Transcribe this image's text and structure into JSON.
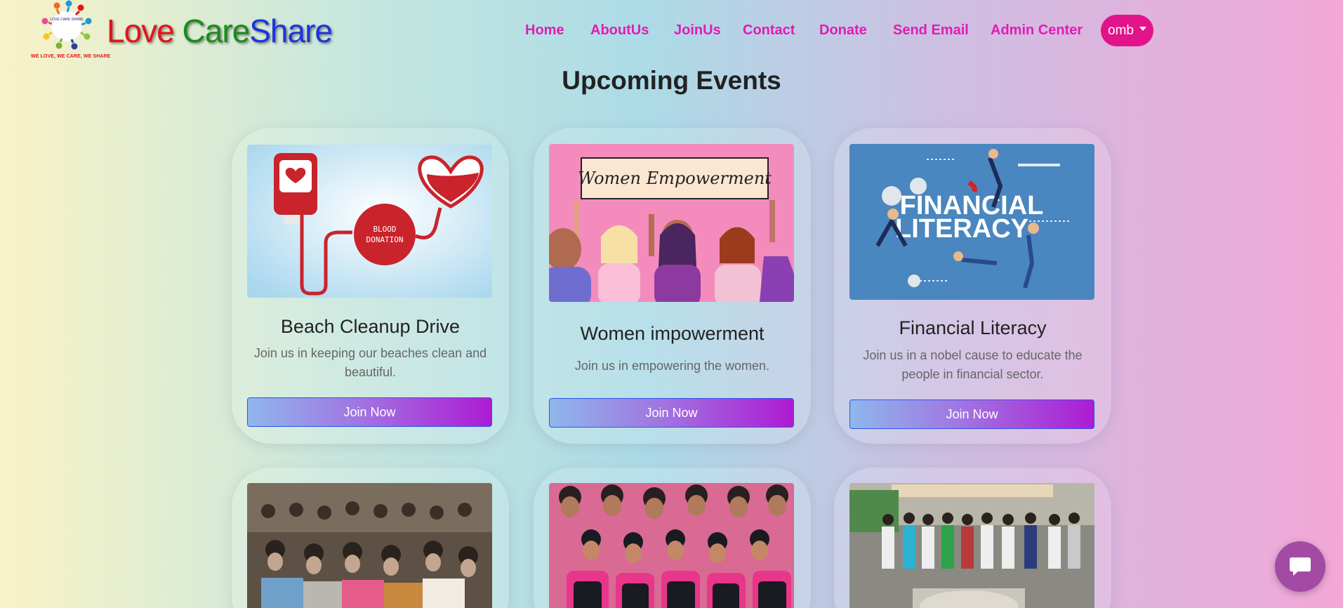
{
  "brand": {
    "word1": "Love",
    "word2": "Care",
    "word3": "Share",
    "tagline": "WE LOVE, WE CARE, WE SHARE",
    "logo_text": "LOVE CARE SHARE"
  },
  "nav": {
    "items": [
      "Home",
      "AboutUs",
      "JoinUs",
      "Contact",
      "Donate",
      "Send Email",
      "Admin Center"
    ],
    "user_label": "omb"
  },
  "section_title": "Upcoming Events",
  "events": [
    {
      "title": "Beach Cleanup Drive",
      "description": "Join us in keeping our beaches clean and beautiful.",
      "button": "Join Now",
      "image_text": "BLOOD DONATION"
    },
    {
      "title": "Women impowerment",
      "description": "Join us in empowering the women.",
      "button": "Join Now",
      "image_text": "Women Empowerment"
    },
    {
      "title": "Financial Literacy",
      "description": "Join us in a nobel cause to educate the people in financial sector.",
      "button": "Join Now",
      "image_text": "FINANCIAL LITERACY"
    }
  ],
  "icons": {
    "chat": "chat-bubble-icon",
    "dropdown": "caret-down-icon"
  },
  "colors": {
    "nav_link": "#e11cb5",
    "user_button": "#e3148a",
    "brand_love": "#e3141b",
    "brand_care": "#1d8a1d",
    "brand_share": "#1f34d9",
    "chat_button": "#a34aa4"
  }
}
